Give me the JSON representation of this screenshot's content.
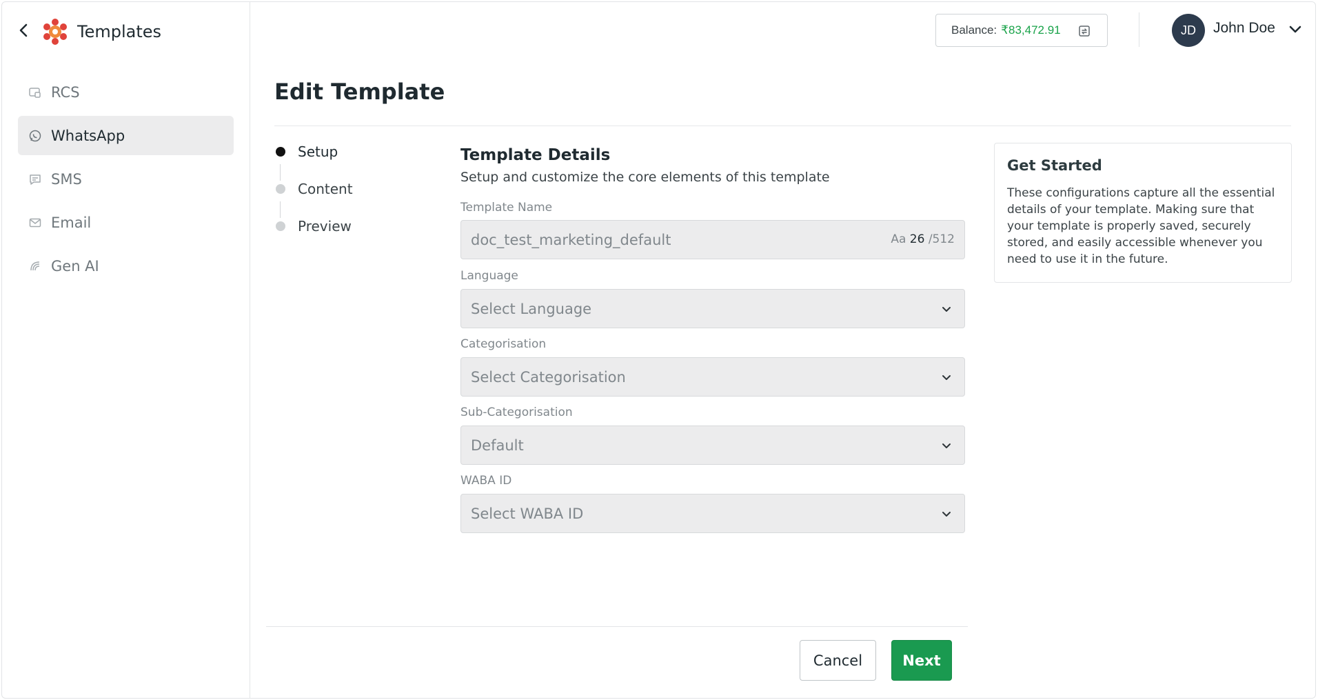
{
  "app": {
    "title": "Templates"
  },
  "sidebar": {
    "items": [
      {
        "label": "RCS",
        "icon": "rcs-icon"
      },
      {
        "label": "WhatsApp",
        "icon": "whatsapp-icon",
        "active": true
      },
      {
        "label": "SMS",
        "icon": "sms-icon"
      },
      {
        "label": "Email",
        "icon": "email-icon"
      },
      {
        "label": "Gen AI",
        "icon": "gen-ai-icon"
      }
    ]
  },
  "header": {
    "balance_label": "Balance:",
    "balance_amount": "₹83,472.91",
    "user_initials": "JD",
    "user_name": "John Doe"
  },
  "page": {
    "title": "Edit Template"
  },
  "stepper": {
    "steps": [
      {
        "label": "Setup",
        "active": true
      },
      {
        "label": "Content"
      },
      {
        "label": "Preview"
      }
    ]
  },
  "form": {
    "section_title": "Template Details",
    "section_subtitle": "Setup and customize the core elements of this template",
    "template_name": {
      "label": "Template Name",
      "value": "doc_test_marketing_default",
      "counter_prefix": "Aa",
      "counter_count": "26",
      "counter_max": "/512"
    },
    "language": {
      "label": "Language",
      "value": "Select Language"
    },
    "categorisation": {
      "label": "Categorisation",
      "value": "Select Categorisation"
    },
    "sub_categorisation": {
      "label": "Sub-Categorisation",
      "value": "Default"
    },
    "waba_id": {
      "label": "WABA ID",
      "value": "Select WABA ID"
    }
  },
  "info_card": {
    "title": "Get Started",
    "body": "These configurations capture all the essential details of your template. Making sure that your template is properly saved, securely stored, and easily accessible whenever you need to use it in the future."
  },
  "footer": {
    "cancel_label": "Cancel",
    "next_label": "Next"
  },
  "colors": {
    "accent": "#1a9a50",
    "balance": "#1aa34a",
    "avatar_bg": "#2d3b4d",
    "logo": "#e0433a"
  }
}
